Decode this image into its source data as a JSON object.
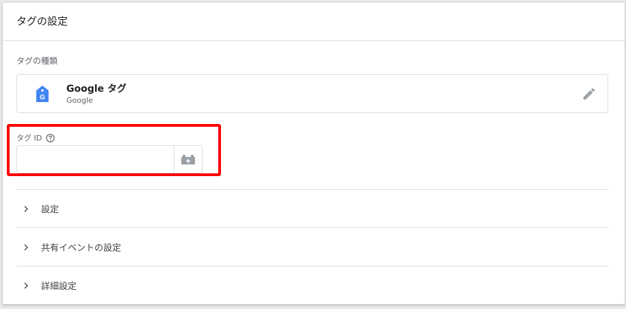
{
  "header": {
    "title": "タグの設定"
  },
  "tag_type": {
    "section_label": "タグの種類",
    "name": "Google タグ",
    "vendor": "Google",
    "icon": "google-tag-icon",
    "edit_icon": "pencil-icon"
  },
  "tag_id": {
    "label": "タグ ID",
    "value": "",
    "placeholder": "",
    "help_icon": "help-circle-icon",
    "variable_icon": "variable-block-icon"
  },
  "sections": [
    {
      "label": "設定"
    },
    {
      "label": "共有イベントの設定"
    },
    {
      "label": "詳細設定"
    }
  ],
  "colors": {
    "accent": "#4285f4",
    "highlight": "#ff0000",
    "border": "#dadce0"
  }
}
